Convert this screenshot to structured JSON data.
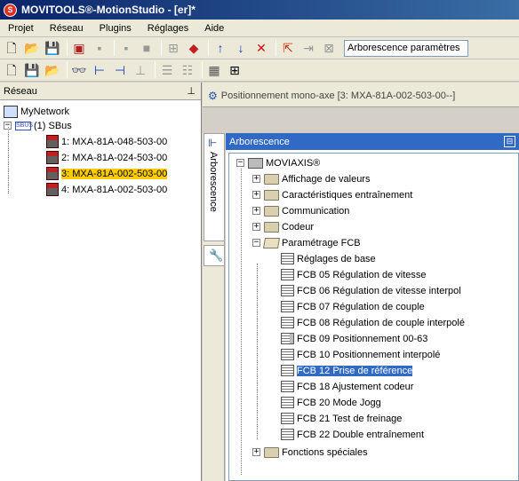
{
  "window": {
    "title": "MOVITOOLS®-MotionStudio - [er]*"
  },
  "menu": [
    {
      "label": "Projet"
    },
    {
      "label": "Réseau"
    },
    {
      "label": "Plugins"
    },
    {
      "label": "Réglages"
    },
    {
      "label": "Aide"
    }
  ],
  "toolbar": {
    "dropdown_value": "Arborescence paramètres"
  },
  "left_panel": {
    "title": "Réseau",
    "pin": "⊥",
    "network": "MyNetwork",
    "bus_badge": "SBUS",
    "bus": "(1) SBus",
    "devices": [
      {
        "label": "1: MXA-81A-048-503-00"
      },
      {
        "label": "2: MXA-81A-024-503-00"
      },
      {
        "label": "3: MXA-81A-002-503-00"
      },
      {
        "label": "4: MXA-81A-002-503-00"
      }
    ]
  },
  "document": {
    "tab_title": "Positionnement mono-axe [3: MXA-81A-002-503-00--]"
  },
  "side_tabs": {
    "arborescence": "Arborescence"
  },
  "tree_panel": {
    "title": "Arborescence",
    "root": "MOVIAXIS®",
    "nodes": [
      {
        "label": "Affichage de valeurs"
      },
      {
        "label": "Caractéristiques entraînement"
      },
      {
        "label": "Communication"
      },
      {
        "label": " Codeur"
      },
      {
        "label": "Paramétrage FCB"
      }
    ],
    "fcb_children": [
      {
        "label": "Réglages de base"
      },
      {
        "label": "FCB 05 Régulation de vitesse"
      },
      {
        "label": "FCB 06 Régulation de vitesse interpol"
      },
      {
        "label": "FCB 07 Régulation de couple"
      },
      {
        "label": "FCB 08 Régulation de couple interpolé"
      },
      {
        "label": "FCB 09 Positionnement 00-63"
      },
      {
        "label": "FCB 10 Positionnement interpolé"
      },
      {
        "label": "FCB 12 Prise de référence"
      },
      {
        "label": "FCB 18 Ajustement codeur"
      },
      {
        "label": "FCB 20 Mode Jogg"
      },
      {
        "label": "FCB 21 Test de freinage"
      },
      {
        "label": "FCB 22 Double entraînement"
      }
    ],
    "last_node": "Fonctions spéciales"
  }
}
